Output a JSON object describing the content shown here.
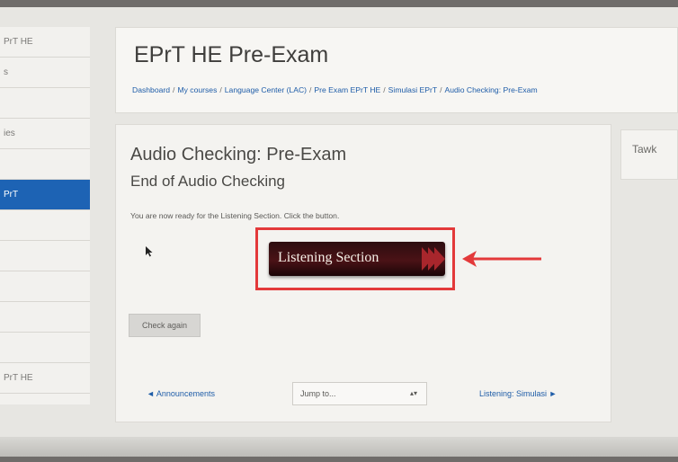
{
  "sidebar": {
    "items": [
      {
        "label": "PrT HE"
      },
      {
        "label": "s"
      },
      {
        "label": ""
      },
      {
        "label": "ies"
      },
      {
        "label": ""
      },
      {
        "label": "PrT"
      },
      {
        "label": ""
      },
      {
        "label": ""
      },
      {
        "label": ""
      },
      {
        "label": ""
      },
      {
        "label": ""
      },
      {
        "label": "PrT HE"
      }
    ],
    "active_index": 5
  },
  "header": {
    "title": "EPrT HE Pre-Exam",
    "breadcrumb": [
      "Dashboard",
      "My courses",
      "Language Center (LAC)",
      "Pre Exam EPrT HE",
      "Simulasi EPrT",
      "Audio Checking: Pre-Exam"
    ],
    "breadcrumb_sep": "/"
  },
  "activity": {
    "title": "Audio Checking: Pre-Exam",
    "subtitle": "End of Audio Checking",
    "instruction": "You are now ready for the Listening Section. Click the button.",
    "listening_button_label": "Listening Section",
    "check_again_label": "Check again"
  },
  "navigation": {
    "prev_label": "◄ Announcements",
    "jump_placeholder": "Jump to...",
    "next_label": "Listening: Simulasi ►"
  },
  "tawk": {
    "title": "Tawk"
  },
  "colors": {
    "accent": "#1d63b4",
    "link": "#1f5da8",
    "highlight": "#e3393a",
    "listening_button": "#4a1216"
  },
  "icons": {
    "cursor": "mouse-pointer-icon",
    "annotation": "red-arrow-left-icon",
    "button_chevrons": "triple-chevron-right-icon"
  }
}
